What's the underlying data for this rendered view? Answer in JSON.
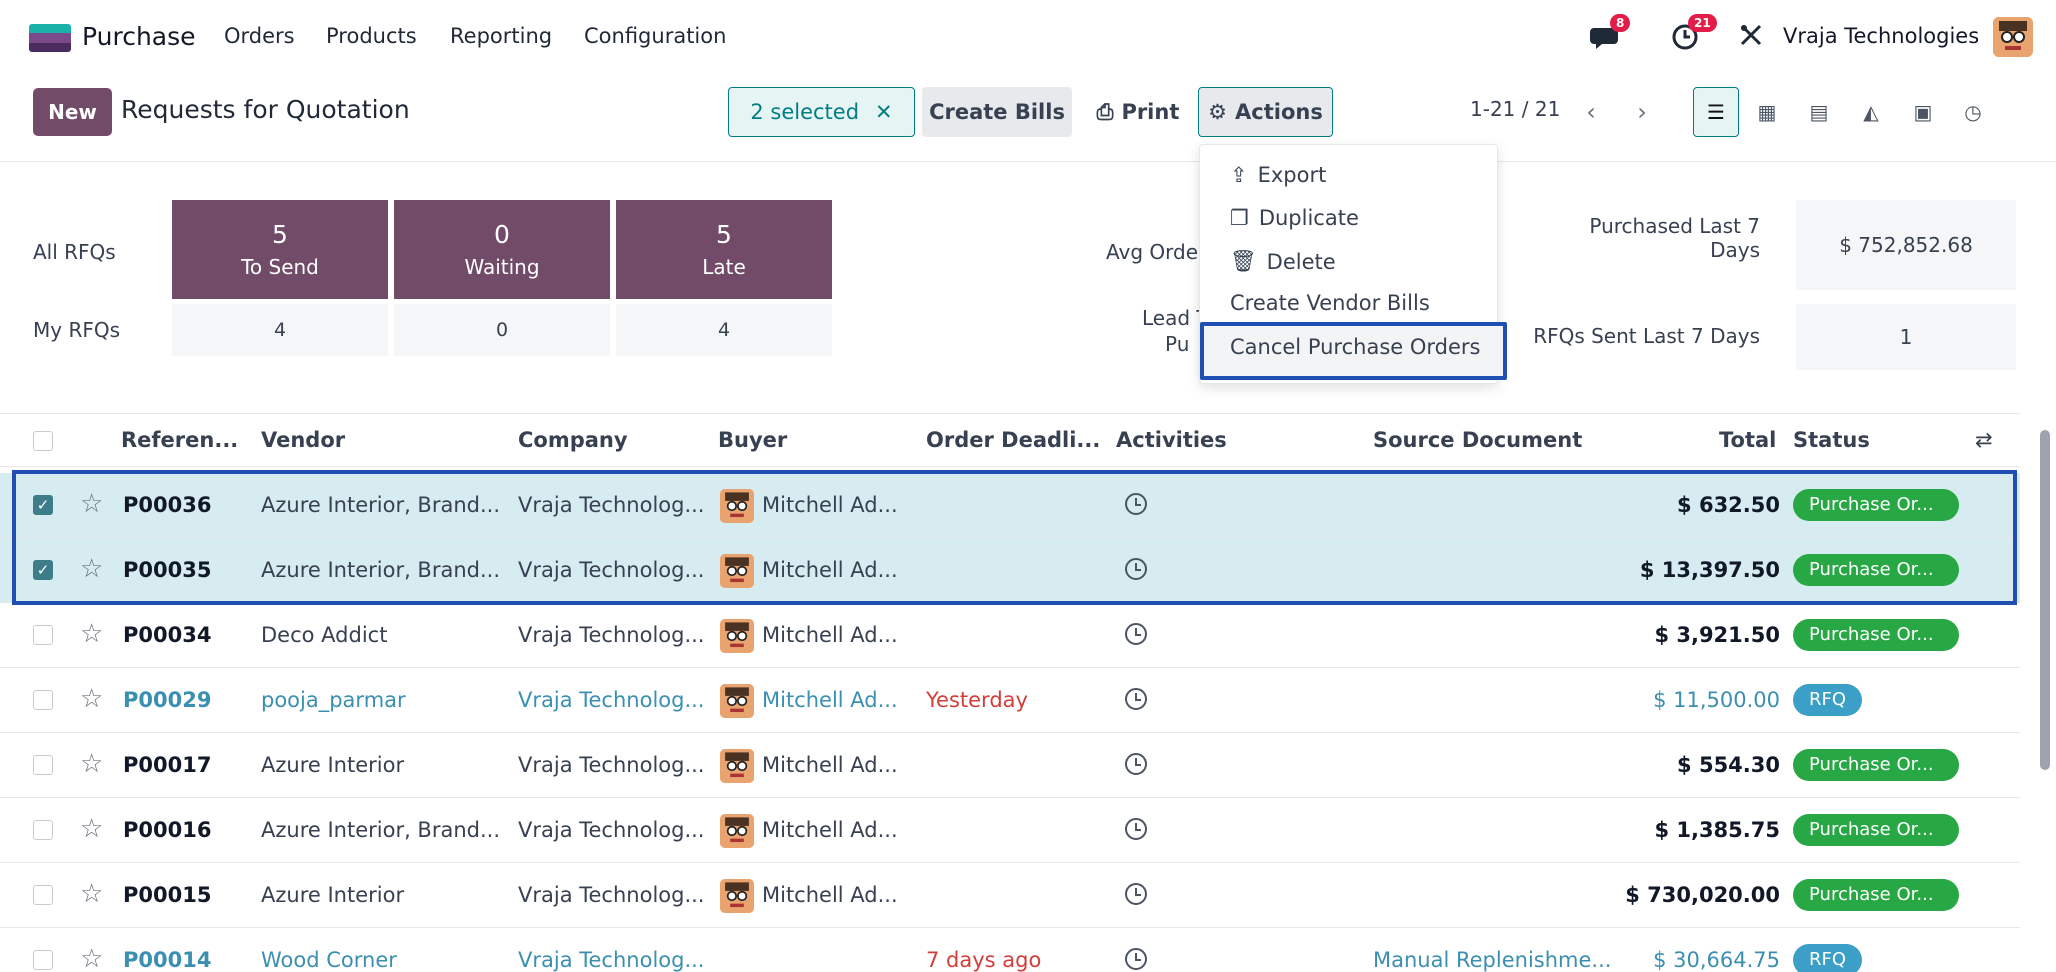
{
  "navbar": {
    "app_name": "Purchase",
    "menu": [
      "Orders",
      "Products",
      "Reporting",
      "Configuration"
    ],
    "messages_count": "8",
    "activities_count": "21",
    "company": "Vraja Technologies"
  },
  "control_panel": {
    "new_label": "New",
    "breadcrumb": "Requests for Quotation",
    "selected_label": "2 selected",
    "create_bills_label": "Create Bills",
    "print_label": "Print",
    "actions_label": "Actions",
    "pager": "1-21 / 21"
  },
  "actions_menu": [
    "Export",
    "Duplicate",
    "Delete",
    "Create Vendor Bills",
    "Cancel Purchase Orders"
  ],
  "dashboard": {
    "all_rfqs_label": "All RFQs",
    "my_rfqs_label": "My RFQs",
    "tiles": [
      {
        "num": "5",
        "label": "To Send",
        "mine": "4"
      },
      {
        "num": "0",
        "label": "Waiting",
        "mine": "0"
      },
      {
        "num": "5",
        "label": "Late",
        "mine": "4"
      }
    ],
    "avg_order_label": "Avg Orde",
    "lead_label": "Lead T",
    "lead_label2": "Pu",
    "purchased_label": "Purchased Last 7 Days",
    "purchased_value": "$ 752,852.68",
    "rfqs_sent_label": "RFQs Sent Last 7 Days",
    "rfqs_sent_value": "1"
  },
  "table": {
    "headers": {
      "reference": "Referen...",
      "vendor": "Vendor",
      "company": "Company",
      "buyer": "Buyer",
      "deadline": "Order Deadli...",
      "activities": "Activities",
      "source": "Source Document",
      "total": "Total",
      "status": "Status"
    },
    "rows": [
      {
        "ref": "P00036",
        "vendor": "Azure Interior, Brand...",
        "company": "Vraja Technolog...",
        "buyer": "Mitchell Ad...",
        "deadline": "",
        "source": "",
        "total": "$ 632.50",
        "status": "Purchase Or..."
      },
      {
        "ref": "P00035",
        "vendor": "Azure Interior, Brand...",
        "company": "Vraja Technolog...",
        "buyer": "Mitchell Ad...",
        "deadline": "",
        "source": "",
        "total": "$ 13,397.50",
        "status": "Purchase Or..."
      },
      {
        "ref": "P00034",
        "vendor": "Deco Addict",
        "company": "Vraja Technolog...",
        "buyer": "Mitchell Ad...",
        "deadline": "",
        "source": "",
        "total": "$ 3,921.50",
        "status": "Purchase Or..."
      },
      {
        "ref": "P00029",
        "vendor": "pooja_parmar",
        "company": "Vraja Technolog...",
        "buyer": "Mitchell Ad...",
        "deadline": "Yesterday",
        "source": "",
        "total": "$ 11,500.00",
        "status": "RFQ"
      },
      {
        "ref": "P00017",
        "vendor": "Azure Interior",
        "company": "Vraja Technolog...",
        "buyer": "Mitchell Ad...",
        "deadline": "",
        "source": "",
        "total": "$ 554.30",
        "status": "Purchase Or..."
      },
      {
        "ref": "P00016",
        "vendor": "Azure Interior, Brand...",
        "company": "Vraja Technolog...",
        "buyer": "Mitchell Ad...",
        "deadline": "",
        "source": "",
        "total": "$ 1,385.75",
        "status": "Purchase Or..."
      },
      {
        "ref": "P00015",
        "vendor": "Azure Interior",
        "company": "Vraja Technolog...",
        "buyer": "Mitchell Ad...",
        "deadline": "",
        "source": "",
        "total": "$ 730,020.00",
        "status": "Purchase Or..."
      },
      {
        "ref": "P00014",
        "vendor": "Wood Corner",
        "company": "Vraja Technolog...",
        "buyer": "",
        "deadline": "7 days ago",
        "source": "Manual Replenishme...",
        "total": "$ 30,664.75",
        "status": "RFQ"
      }
    ]
  },
  "colors": {
    "brand": "#714b67",
    "accent": "#017e84",
    "highlight_outline": "#1f4fb3",
    "status_po": "#28a745",
    "status_rfq": "#3b9fc7",
    "late": "#d23f3a"
  }
}
